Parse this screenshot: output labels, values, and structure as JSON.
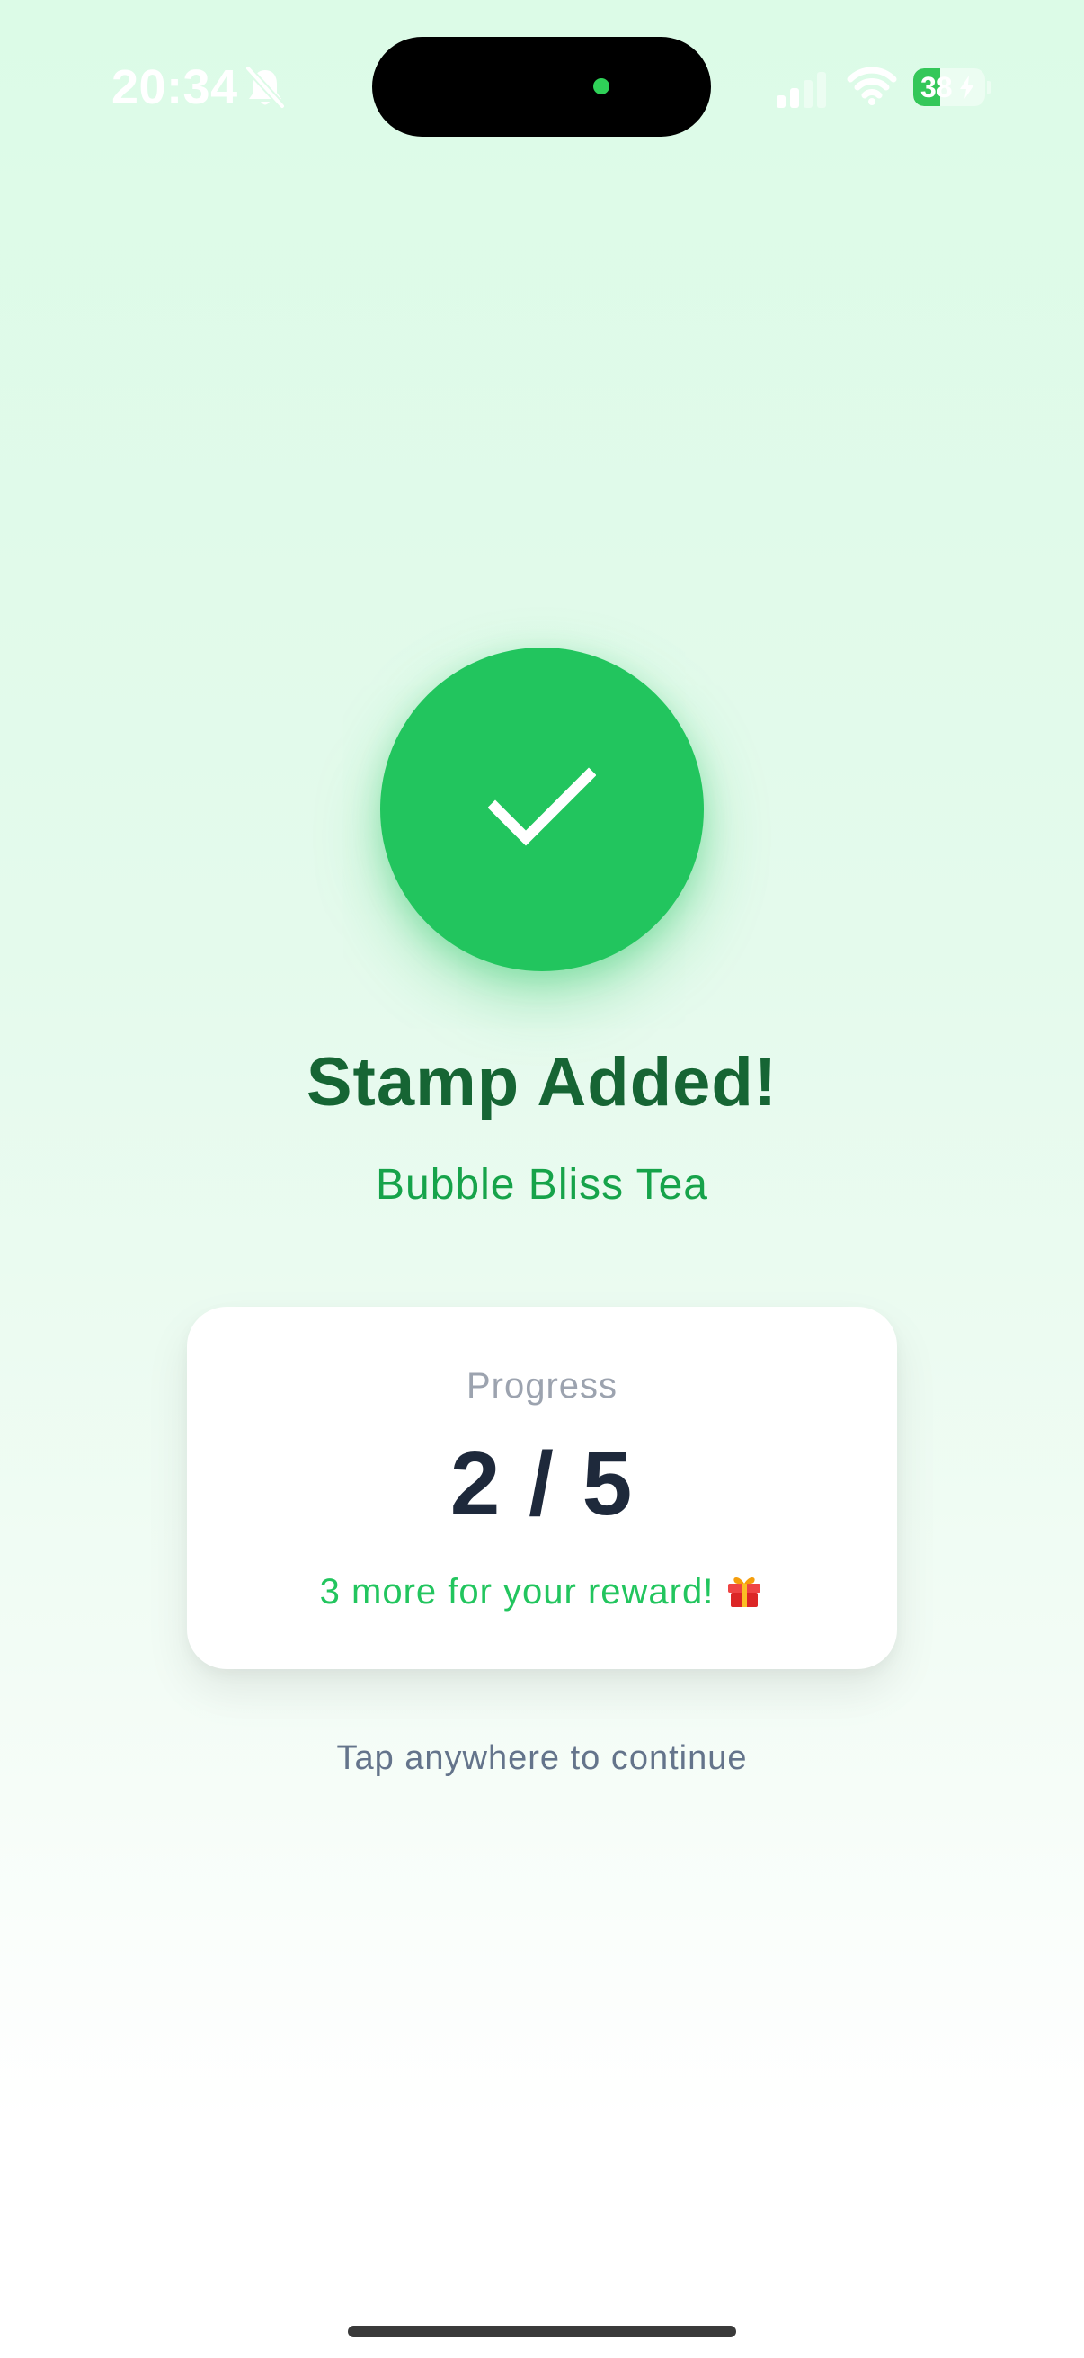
{
  "status_bar": {
    "time": "20:34",
    "battery_level": "38",
    "battery_percent": 38,
    "icons": [
      "bell-slash-icon",
      "signal-icon",
      "wifi-icon",
      "battery-charging-icon"
    ]
  },
  "success": {
    "icon": "checkmark-icon",
    "title": "Stamp Added!",
    "merchant": "Bubble Bliss Tea"
  },
  "progress": {
    "label": "Progress",
    "value": "2 / 5",
    "current": 2,
    "total": 5,
    "note": "3 more for your reward!",
    "note_icon": "gift-icon"
  },
  "hint": "Tap anywhere to continue",
  "colors": {
    "accent": "#22c55e",
    "title": "#166534",
    "merchant": "#16a34a",
    "value": "#1e293b"
  }
}
